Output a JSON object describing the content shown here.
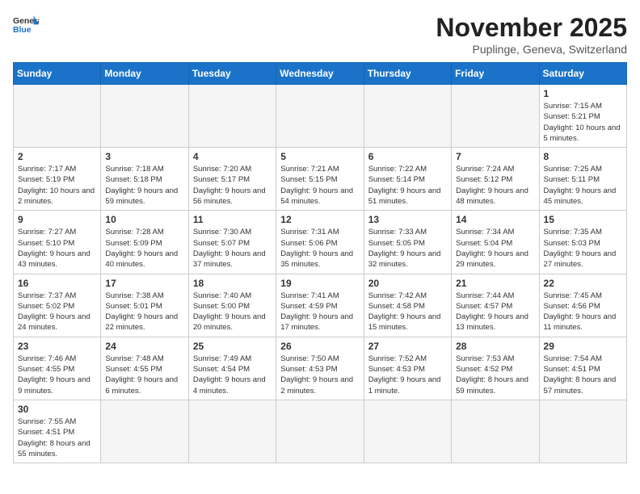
{
  "header": {
    "logo_general": "General",
    "logo_blue": "Blue",
    "month_title": "November 2025",
    "subtitle": "Puplinge, Geneva, Switzerland"
  },
  "weekdays": [
    "Sunday",
    "Monday",
    "Tuesday",
    "Wednesday",
    "Thursday",
    "Friday",
    "Saturday"
  ],
  "weeks": [
    [
      {
        "day": "",
        "info": ""
      },
      {
        "day": "",
        "info": ""
      },
      {
        "day": "",
        "info": ""
      },
      {
        "day": "",
        "info": ""
      },
      {
        "day": "",
        "info": ""
      },
      {
        "day": "",
        "info": ""
      },
      {
        "day": "1",
        "info": "Sunrise: 7:15 AM\nSunset: 5:21 PM\nDaylight: 10 hours and 5 minutes."
      }
    ],
    [
      {
        "day": "2",
        "info": "Sunrise: 7:17 AM\nSunset: 5:19 PM\nDaylight: 10 hours and 2 minutes."
      },
      {
        "day": "3",
        "info": "Sunrise: 7:18 AM\nSunset: 5:18 PM\nDaylight: 9 hours and 59 minutes."
      },
      {
        "day": "4",
        "info": "Sunrise: 7:20 AM\nSunset: 5:17 PM\nDaylight: 9 hours and 56 minutes."
      },
      {
        "day": "5",
        "info": "Sunrise: 7:21 AM\nSunset: 5:15 PM\nDaylight: 9 hours and 54 minutes."
      },
      {
        "day": "6",
        "info": "Sunrise: 7:22 AM\nSunset: 5:14 PM\nDaylight: 9 hours and 51 minutes."
      },
      {
        "day": "7",
        "info": "Sunrise: 7:24 AM\nSunset: 5:12 PM\nDaylight: 9 hours and 48 minutes."
      },
      {
        "day": "8",
        "info": "Sunrise: 7:25 AM\nSunset: 5:11 PM\nDaylight: 9 hours and 45 minutes."
      }
    ],
    [
      {
        "day": "9",
        "info": "Sunrise: 7:27 AM\nSunset: 5:10 PM\nDaylight: 9 hours and 43 minutes."
      },
      {
        "day": "10",
        "info": "Sunrise: 7:28 AM\nSunset: 5:09 PM\nDaylight: 9 hours and 40 minutes."
      },
      {
        "day": "11",
        "info": "Sunrise: 7:30 AM\nSunset: 5:07 PM\nDaylight: 9 hours and 37 minutes."
      },
      {
        "day": "12",
        "info": "Sunrise: 7:31 AM\nSunset: 5:06 PM\nDaylight: 9 hours and 35 minutes."
      },
      {
        "day": "13",
        "info": "Sunrise: 7:33 AM\nSunset: 5:05 PM\nDaylight: 9 hours and 32 minutes."
      },
      {
        "day": "14",
        "info": "Sunrise: 7:34 AM\nSunset: 5:04 PM\nDaylight: 9 hours and 29 minutes."
      },
      {
        "day": "15",
        "info": "Sunrise: 7:35 AM\nSunset: 5:03 PM\nDaylight: 9 hours and 27 minutes."
      }
    ],
    [
      {
        "day": "16",
        "info": "Sunrise: 7:37 AM\nSunset: 5:02 PM\nDaylight: 9 hours and 24 minutes."
      },
      {
        "day": "17",
        "info": "Sunrise: 7:38 AM\nSunset: 5:01 PM\nDaylight: 9 hours and 22 minutes."
      },
      {
        "day": "18",
        "info": "Sunrise: 7:40 AM\nSunset: 5:00 PM\nDaylight: 9 hours and 20 minutes."
      },
      {
        "day": "19",
        "info": "Sunrise: 7:41 AM\nSunset: 4:59 PM\nDaylight: 9 hours and 17 minutes."
      },
      {
        "day": "20",
        "info": "Sunrise: 7:42 AM\nSunset: 4:58 PM\nDaylight: 9 hours and 15 minutes."
      },
      {
        "day": "21",
        "info": "Sunrise: 7:44 AM\nSunset: 4:57 PM\nDaylight: 9 hours and 13 minutes."
      },
      {
        "day": "22",
        "info": "Sunrise: 7:45 AM\nSunset: 4:56 PM\nDaylight: 9 hours and 11 minutes."
      }
    ],
    [
      {
        "day": "23",
        "info": "Sunrise: 7:46 AM\nSunset: 4:55 PM\nDaylight: 9 hours and 9 minutes."
      },
      {
        "day": "24",
        "info": "Sunrise: 7:48 AM\nSunset: 4:55 PM\nDaylight: 9 hours and 6 minutes."
      },
      {
        "day": "25",
        "info": "Sunrise: 7:49 AM\nSunset: 4:54 PM\nDaylight: 9 hours and 4 minutes."
      },
      {
        "day": "26",
        "info": "Sunrise: 7:50 AM\nSunset: 4:53 PM\nDaylight: 9 hours and 2 minutes."
      },
      {
        "day": "27",
        "info": "Sunrise: 7:52 AM\nSunset: 4:53 PM\nDaylight: 9 hours and 1 minute."
      },
      {
        "day": "28",
        "info": "Sunrise: 7:53 AM\nSunset: 4:52 PM\nDaylight: 8 hours and 59 minutes."
      },
      {
        "day": "29",
        "info": "Sunrise: 7:54 AM\nSunset: 4:51 PM\nDaylight: 8 hours and 57 minutes."
      }
    ],
    [
      {
        "day": "30",
        "info": "Sunrise: 7:55 AM\nSunset: 4:51 PM\nDaylight: 8 hours and 55 minutes."
      },
      {
        "day": "",
        "info": ""
      },
      {
        "day": "",
        "info": ""
      },
      {
        "day": "",
        "info": ""
      },
      {
        "day": "",
        "info": ""
      },
      {
        "day": "",
        "info": ""
      },
      {
        "day": "",
        "info": ""
      }
    ]
  ]
}
